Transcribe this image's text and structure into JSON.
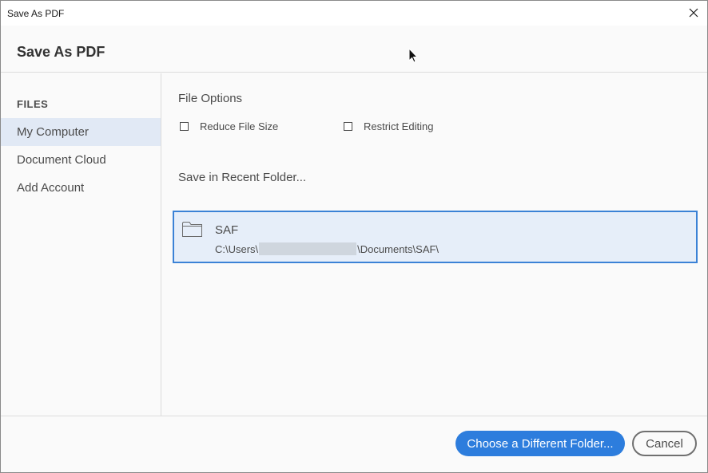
{
  "window": {
    "title": "Save As PDF",
    "close_icon": "close-icon"
  },
  "header": {
    "title": "Save As PDF"
  },
  "sidebar": {
    "section_label": "FILES",
    "items": [
      {
        "label": "My Computer",
        "selected": true
      },
      {
        "label": "Document Cloud",
        "selected": false
      },
      {
        "label": "Add Account",
        "selected": false
      }
    ]
  },
  "file_options": {
    "title": "File Options",
    "checkboxes": [
      {
        "label": "Reduce File Size",
        "checked": false
      },
      {
        "label": "Restrict Editing",
        "checked": false
      }
    ]
  },
  "recent": {
    "title": "Save in Recent Folder...",
    "folders": [
      {
        "name": "SAF",
        "path_prefix": "C:\\Users\\",
        "path_suffix": "\\Documents\\SAF\\",
        "icon": "folder-icon"
      }
    ]
  },
  "footer": {
    "choose_label": "Choose a Different Folder...",
    "cancel_label": "Cancel"
  },
  "colors": {
    "accent": "#2d7ddd",
    "selected_bg": "#e1e9f5",
    "row_selected_bg": "#e6eef9",
    "row_selected_border": "#3b82d6"
  }
}
